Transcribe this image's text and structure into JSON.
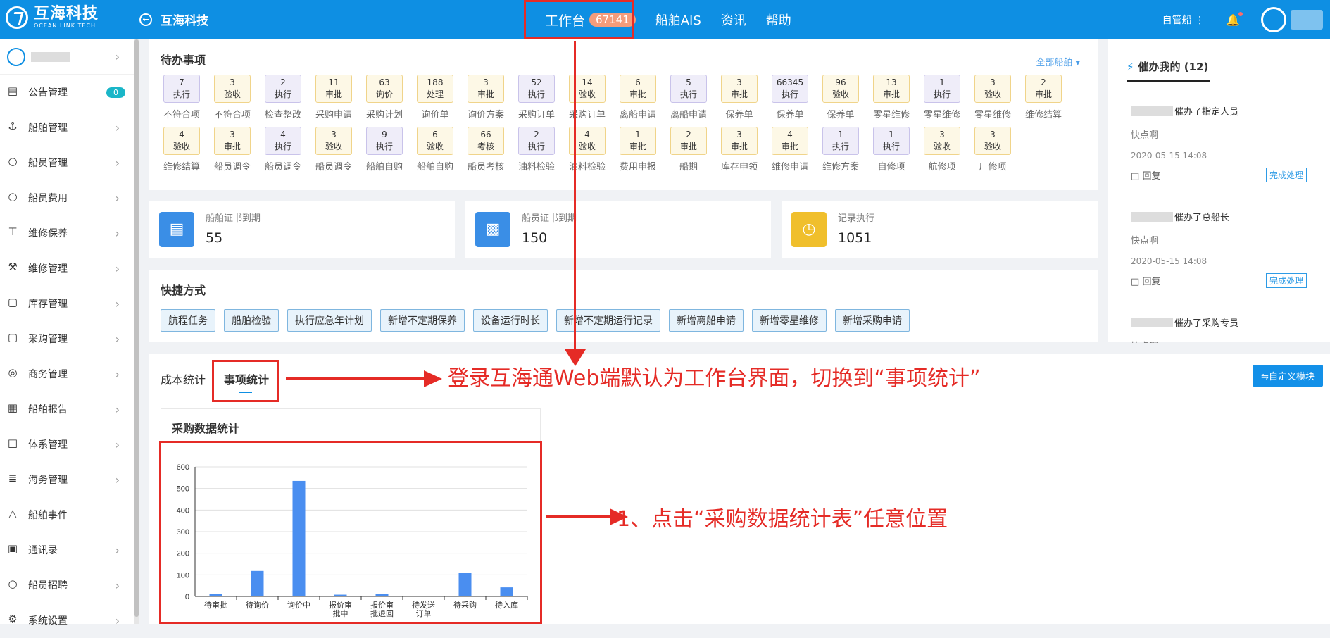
{
  "topbar": {
    "logo_cn": "互海科技",
    "logo_en": "OCEAN LINK TECH",
    "back_label": "互海科技",
    "nav": [
      {
        "label": "工作台",
        "badge": "67141"
      },
      {
        "label": "船舶AIS"
      },
      {
        "label": "资讯"
      },
      {
        "label": "帮助"
      }
    ],
    "user_menu": "自管船"
  },
  "sidebar": {
    "items": [
      {
        "label": "公告管理",
        "icon": "book-icon",
        "count": "0"
      },
      {
        "label": "船舶管理",
        "icon": "anchor-icon"
      },
      {
        "label": "船员管理",
        "icon": "user-icon"
      },
      {
        "label": "船员费用",
        "icon": "user-icon"
      },
      {
        "label": "维修保养",
        "icon": "hammer-icon"
      },
      {
        "label": "维修管理",
        "icon": "wrench-icon"
      },
      {
        "label": "库存管理",
        "icon": "bag-icon"
      },
      {
        "label": "采购管理",
        "icon": "bag-icon"
      },
      {
        "label": "商务管理",
        "icon": "globe-icon"
      },
      {
        "label": "船舶报告",
        "icon": "calendar-icon"
      },
      {
        "label": "体系管理",
        "icon": "doc-icon"
      },
      {
        "label": "海务管理",
        "icon": "sign-icon"
      },
      {
        "label": "船舶事件",
        "icon": "warning-icon"
      },
      {
        "label": "通讯录",
        "icon": "contacts-icon"
      },
      {
        "label": "船员招聘",
        "icon": "user-icon"
      },
      {
        "label": "系统设置",
        "icon": "gear-icon"
      }
    ]
  },
  "todo": {
    "title": "待办事项",
    "all_ships": "全部船舶",
    "rows": [
      [
        {
          "n": "7",
          "s": "执行",
          "l": "不符合项",
          "c": "p"
        },
        {
          "n": "3",
          "s": "验收",
          "l": "不符合项",
          "c": "y"
        },
        {
          "n": "2",
          "s": "执行",
          "l": "检查整改",
          "c": "p"
        },
        {
          "n": "11",
          "s": "审批",
          "l": "采购申请",
          "c": "y"
        },
        {
          "n": "63",
          "s": "询价",
          "l": "采购计划",
          "c": "y"
        },
        {
          "n": "188",
          "s": "处理",
          "l": "询价单",
          "c": "y"
        },
        {
          "n": "3",
          "s": "审批",
          "l": "询价方案",
          "c": "y"
        },
        {
          "n": "52",
          "s": "执行",
          "l": "采购订单",
          "c": "p"
        },
        {
          "n": "14",
          "s": "验收",
          "l": "采购订单",
          "c": "y"
        },
        {
          "n": "6",
          "s": "审批",
          "l": "离船申请",
          "c": "y"
        },
        {
          "n": "5",
          "s": "执行",
          "l": "离船申请",
          "c": "p"
        },
        {
          "n": "3",
          "s": "审批",
          "l": "保养单",
          "c": "y"
        },
        {
          "n": "66345",
          "s": "执行",
          "l": "保养单",
          "c": "p"
        },
        {
          "n": "96",
          "s": "验收",
          "l": "保养单",
          "c": "y"
        },
        {
          "n": "13",
          "s": "审批",
          "l": "零星维修",
          "c": "y"
        },
        {
          "n": "1",
          "s": "执行",
          "l": "零星维修",
          "c": "p"
        },
        {
          "n": "3",
          "s": "验收",
          "l": "零星维修",
          "c": "y"
        },
        {
          "n": "2",
          "s": "审批",
          "l": "维修结算",
          "c": "y"
        }
      ],
      [
        {
          "n": "4",
          "s": "验收",
          "l": "维修结算",
          "c": "y"
        },
        {
          "n": "3",
          "s": "审批",
          "l": "船员调令",
          "c": "y"
        },
        {
          "n": "4",
          "s": "执行",
          "l": "船员调令",
          "c": "p"
        },
        {
          "n": "3",
          "s": "验收",
          "l": "船员调令",
          "c": "y"
        },
        {
          "n": "9",
          "s": "执行",
          "l": "船舶自购",
          "c": "p"
        },
        {
          "n": "6",
          "s": "验收",
          "l": "船舶自购",
          "c": "y"
        },
        {
          "n": "66",
          "s": "考核",
          "l": "船员考核",
          "c": "y"
        },
        {
          "n": "2",
          "s": "执行",
          "l": "油料检验",
          "c": "p"
        },
        {
          "n": "4",
          "s": "验收",
          "l": "油料检验",
          "c": "y"
        },
        {
          "n": "1",
          "s": "审批",
          "l": "费用申报",
          "c": "y"
        },
        {
          "n": "2",
          "s": "审批",
          "l": "船期",
          "c": "y"
        },
        {
          "n": "3",
          "s": "审批",
          "l": "库存申领",
          "c": "y"
        },
        {
          "n": "4",
          "s": "审批",
          "l": "维修申请",
          "c": "y"
        },
        {
          "n": "1",
          "s": "执行",
          "l": "维修方案",
          "c": "p"
        },
        {
          "n": "1",
          "s": "执行",
          "l": "自修项",
          "c": "p"
        },
        {
          "n": "3",
          "s": "验收",
          "l": "航修项",
          "c": "y"
        },
        {
          "n": "3",
          "s": "验收",
          "l": "厂修项",
          "c": "y"
        }
      ]
    ]
  },
  "stats": [
    {
      "label": "船舶证书到期",
      "value": "55",
      "color": "#3a8ee6",
      "icon": "certificate-icon"
    },
    {
      "label": "船员证书到期",
      "value": "150",
      "color": "#3a8ee6",
      "icon": "id-card-icon"
    },
    {
      "label": "记录执行",
      "value": "1051",
      "color": "#f0bf2c",
      "icon": "calendar-clock-icon"
    }
  ],
  "quick": {
    "title": "快捷方式",
    "buttons": [
      "航程任务",
      "船舶检验",
      "执行应急年计划",
      "新增不定期保养",
      "设备运行时长",
      "新增不定期运行记录",
      "新增离船申请",
      "新增零星维修",
      "新增采购申请"
    ]
  },
  "urge": {
    "title": "催办我的 (12)",
    "entries": [
      {
        "who": "催办了指定人员",
        "msg": "快点啊",
        "time": "2020-05-15 14:08",
        "reply": "回复",
        "action": "完成处理"
      },
      {
        "who": "催办了总船长",
        "msg": "快点啊",
        "time": "2020-05-15 14:08",
        "reply": "回复",
        "action": "完成处理"
      },
      {
        "who": "催办了采购专员",
        "msg": "快点啊"
      }
    ]
  },
  "statistics": {
    "tabs": [
      "成本统计",
      "事项统计"
    ],
    "custom_btn": "自定义模块",
    "chart_title": "采购数据统计"
  },
  "chart_data": {
    "type": "bar",
    "categories": [
      "待审批",
      "待询价",
      "询价中",
      "报价审批中",
      "报价审批退回",
      "待发送订单",
      "待采购",
      "待入库"
    ],
    "values": [
      12,
      118,
      535,
      8,
      10,
      0,
      108,
      42
    ],
    "ylim": [
      0,
      600
    ],
    "yticks": [
      0,
      100,
      200,
      300,
      400,
      500,
      600
    ],
    "color": "#4a8ef0"
  },
  "annotations": {
    "text1": "登录互海通Web端默认为工作台界面，切换到“事项统计”",
    "text2": "1、点击“采购数据统计表”任意位置"
  }
}
